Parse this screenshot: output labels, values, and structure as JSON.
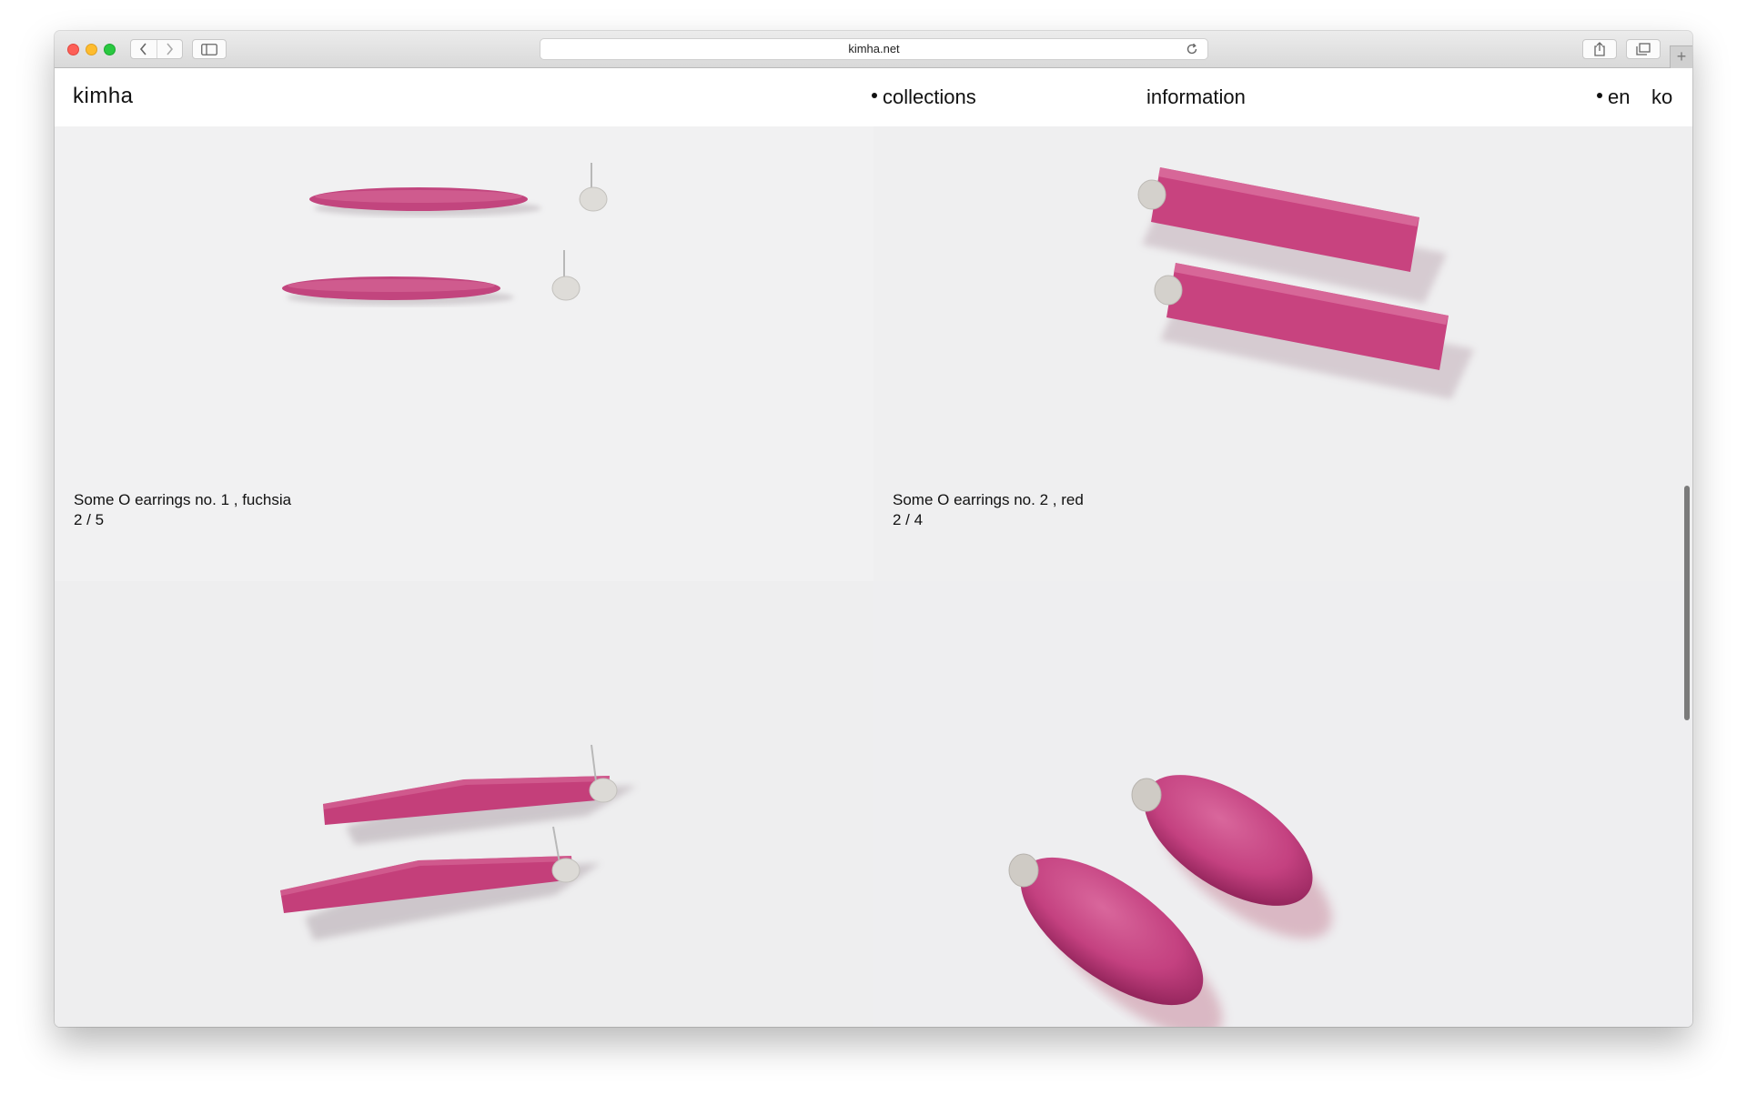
{
  "browser": {
    "url": "kimha.net",
    "icons": {
      "back": "chevron-left-icon",
      "forward": "chevron-right-icon",
      "sidebar": "sidebar-icon",
      "reload": "reload-icon",
      "share": "share-icon",
      "tabs": "tabs-icon",
      "new_tab": "plus-icon"
    },
    "new_tab_label": "+"
  },
  "site": {
    "logo": "kimha",
    "nav": {
      "collections": "collections",
      "information": "information"
    },
    "lang": {
      "en": "en",
      "ko": "ko"
    }
  },
  "products": [
    {
      "title": "Some O earrings no. 1 ,  fuchsia",
      "counter": "2 / 5",
      "color": "#c2457e"
    },
    {
      "title": "Some O earrings no. 2 ,  red",
      "counter": "2 / 4",
      "color": "#c8437f"
    },
    {
      "color": "#c43f7a"
    },
    {
      "color": "#c84580"
    }
  ],
  "colors": {
    "accent_pink": "#c8457f",
    "background": "#f0f0f1",
    "text": "#111111"
  }
}
